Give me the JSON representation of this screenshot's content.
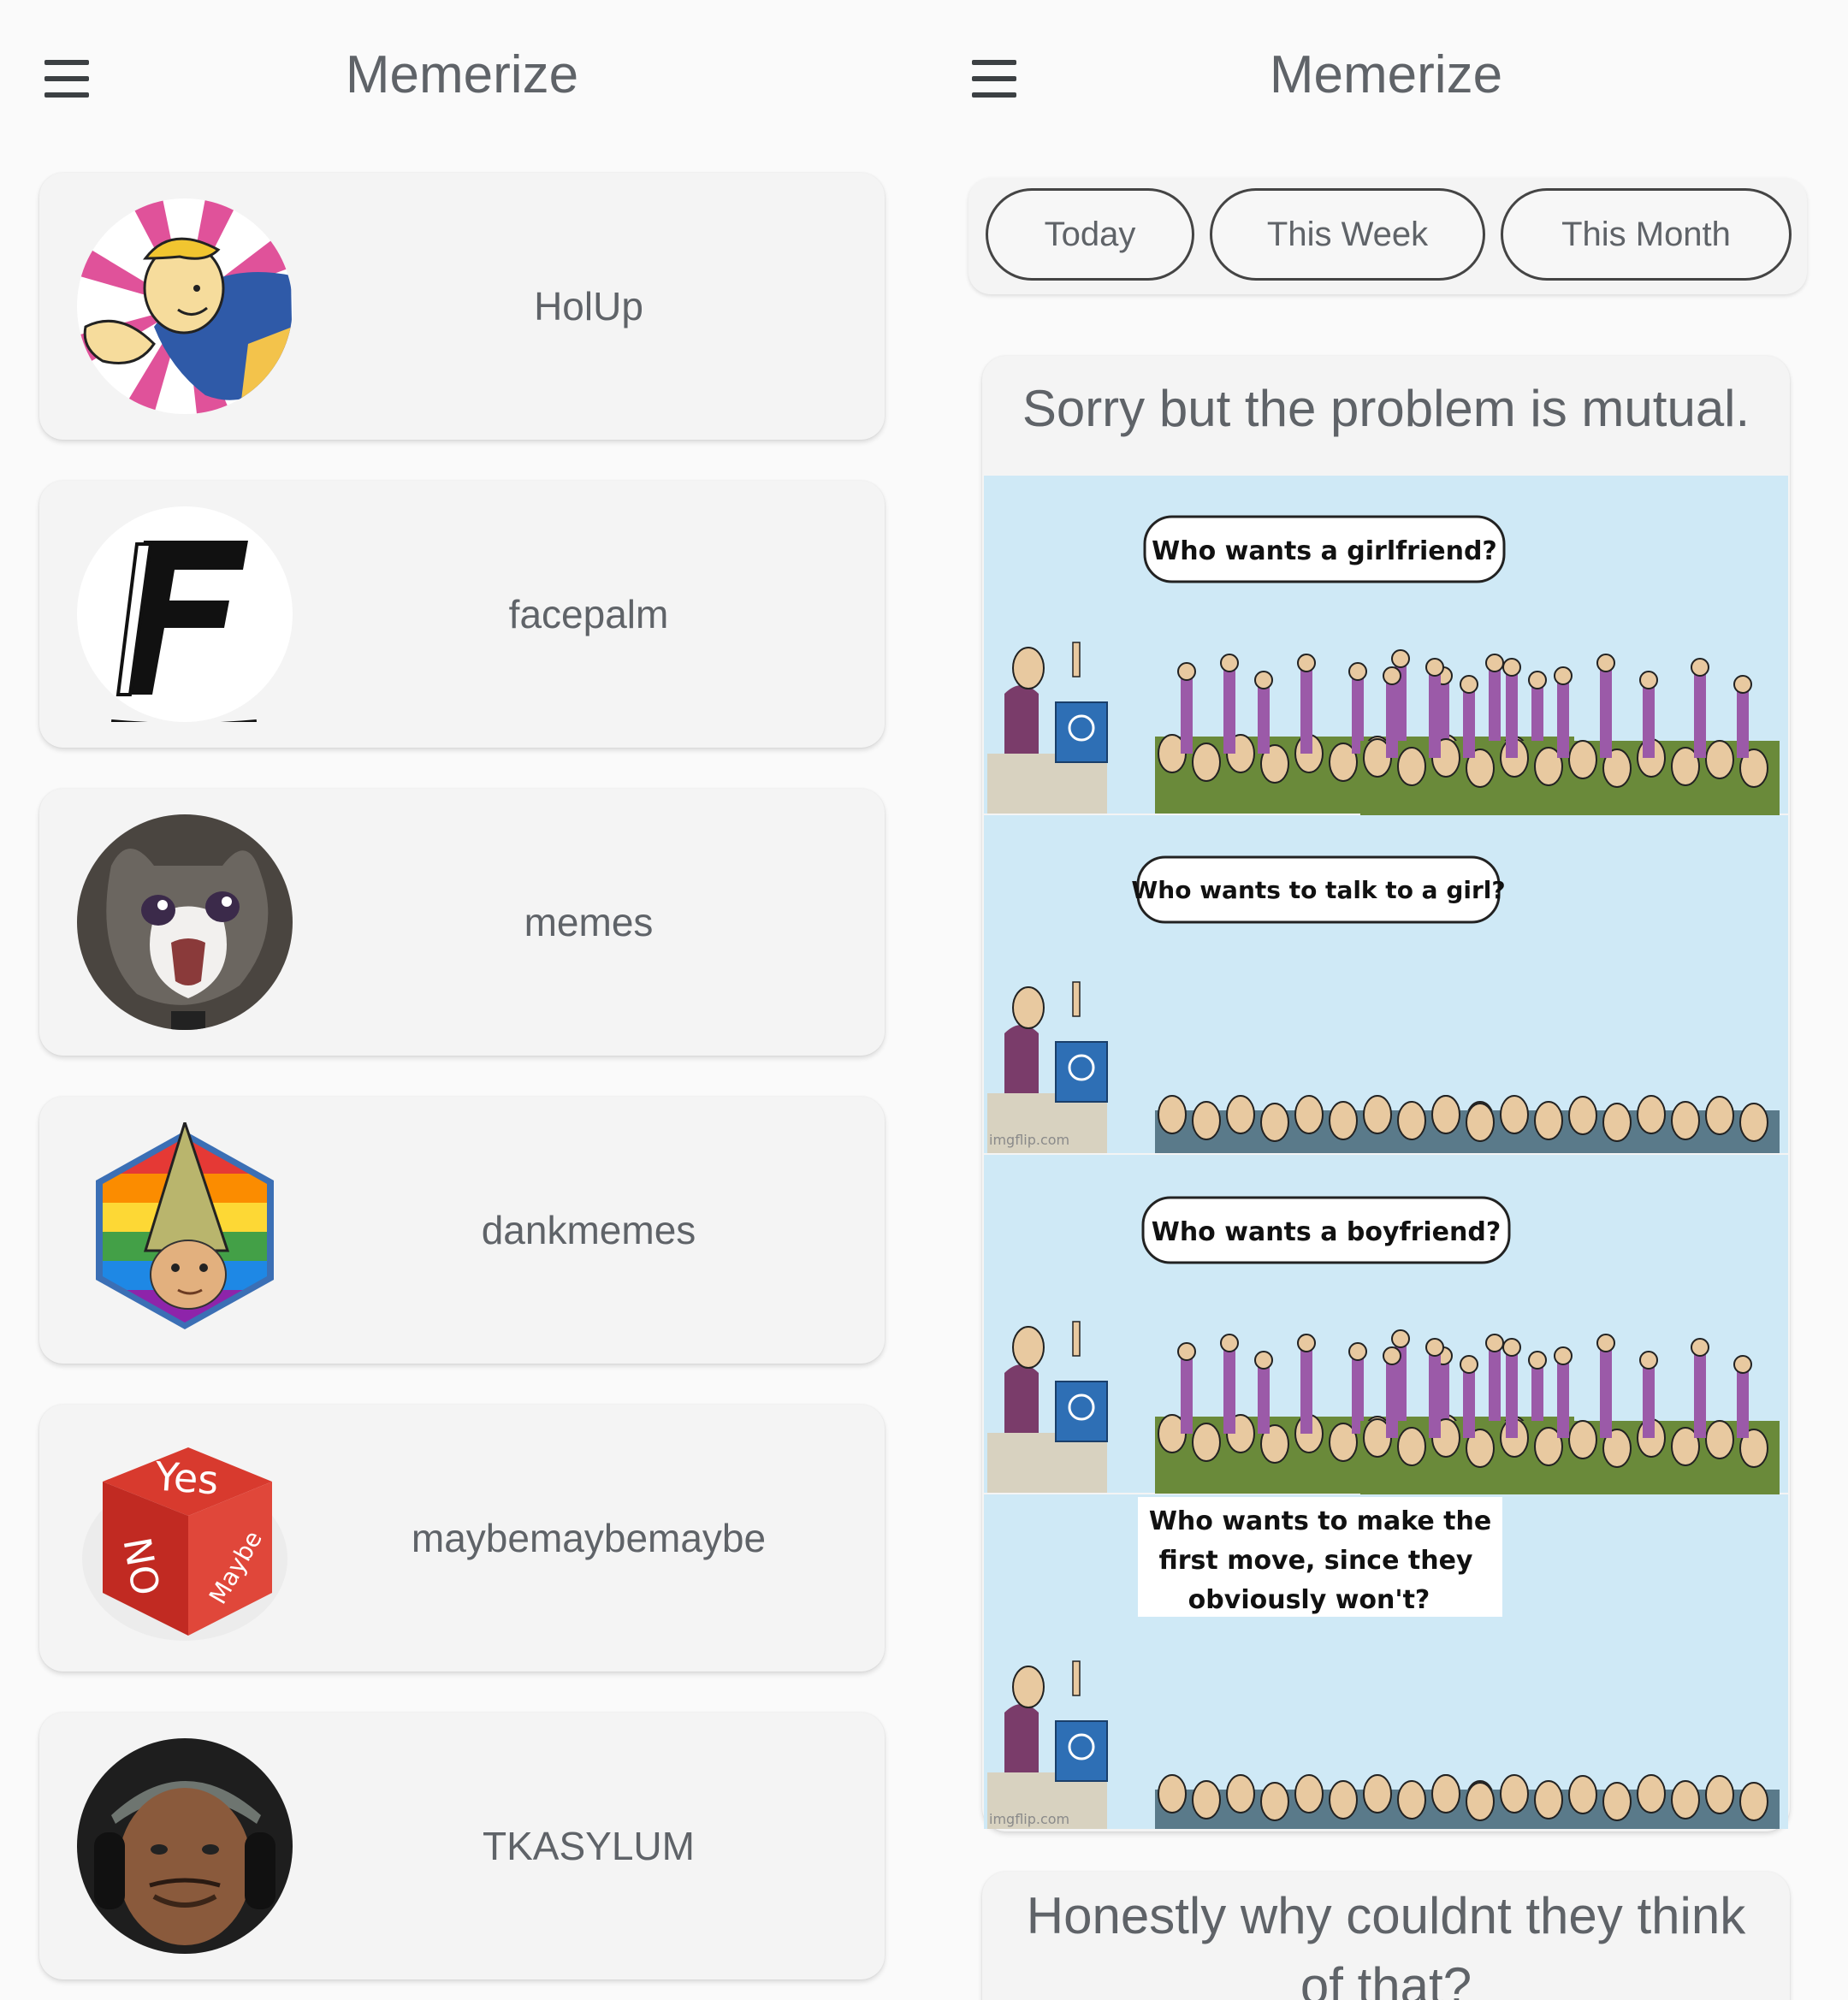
{
  "app": {
    "title": "Memerize"
  },
  "left_screen": {
    "menu_icon": "hamburger-menu-icon",
    "subreddits": [
      {
        "name": "HolUp",
        "icon": "vault-boy-avatar"
      },
      {
        "name": "facepalm",
        "icon": "letter-f-avatar"
      },
      {
        "name": "memes",
        "icon": "crying-cat-avatar"
      },
      {
        "name": "dankmemes",
        "icon": "gnome-rainbow-avatar"
      },
      {
        "name": "maybemaybemaybe",
        "icon": "yes-no-maybe-dice-avatar"
      },
      {
        "name": "TKASYLUM",
        "icon": "person-headphones-avatar"
      }
    ]
  },
  "right_screen": {
    "menu_icon": "hamburger-menu-icon",
    "filters": {
      "today": "Today",
      "this_week": "This Week",
      "this_month": "This Month"
    },
    "posts": [
      {
        "title": "Sorry but the problem is mutual.",
        "image": {
          "panel_1": "Who wants a girlfriend?",
          "panel_2": "Who wants to talk to a girl?",
          "panel_3": "Who wants a boyfriend?",
          "panel_4_line_1": "Who wants to make the",
          "panel_4_line_2": "first move, since they",
          "panel_4_line_3": "obviously won't?",
          "watermark": "imgflip.com"
        }
      },
      {
        "title_line_1": "Honestly why couldnt they think",
        "title_line_2": "of that?"
      }
    ]
  },
  "colors": {
    "background": "#fafafa",
    "card": "#f4f4f4",
    "text": "#5f6368",
    "meme_sky": "#cfe9f6"
  }
}
